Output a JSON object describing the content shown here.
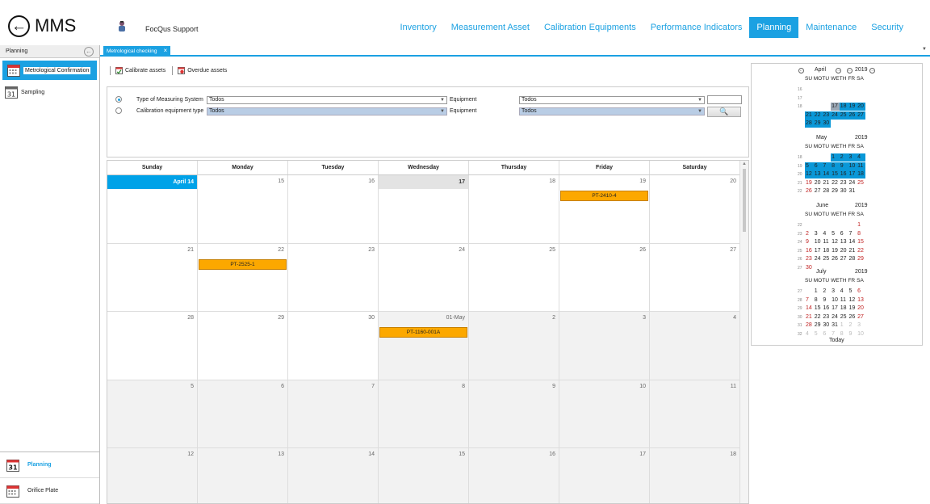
{
  "header": {
    "app_title": "MMS",
    "user_name": "FocQus Support",
    "nav": [
      "Inventory",
      "Measurement Asset",
      "Calibration Equipments",
      "Performance Indicators",
      "Planning",
      "Maintenance",
      "Security"
    ],
    "active_nav": "Planning"
  },
  "left_panel": {
    "title": "Planning",
    "items": [
      "Metrological Confirmation",
      "Sampling"
    ],
    "bottom_items": [
      "Planning",
      "Orifice Plate"
    ]
  },
  "tab": {
    "label": "Metrological checking",
    "close": "×"
  },
  "toolbar": {
    "calibrate": "Calibrate assets",
    "overdue": "Overdue assets"
  },
  "filters": {
    "type_label": "Type of Measuring System",
    "type_value": "Todos",
    "equipment_label_1": "Equipment",
    "equipment_value_1": "Todos",
    "cal_type_label": "Calibration equipment type",
    "cal_type_value": "Todos",
    "equipment_label_2": "Equipment",
    "equipment_value_2": "Todos",
    "search_icon": "🔍"
  },
  "calendar": {
    "days": [
      "Sunday",
      "Monday",
      "Tuesday",
      "Wednesday",
      "Thursday",
      "Friday",
      "Saturday"
    ],
    "weeks": [
      [
        {
          "d": "April 14",
          "today": true
        },
        {
          "d": "15"
        },
        {
          "d": "16"
        },
        {
          "d": "17",
          "sel": true
        },
        {
          "d": "18"
        },
        {
          "d": "19",
          "ev": "PT-2410-4"
        },
        {
          "d": "20"
        }
      ],
      [
        {
          "d": "21"
        },
        {
          "d": "22",
          "ev": "PT-2525-1"
        },
        {
          "d": "23"
        },
        {
          "d": "24"
        },
        {
          "d": "25"
        },
        {
          "d": "26"
        },
        {
          "d": "27"
        }
      ],
      [
        {
          "d": "28"
        },
        {
          "d": "29"
        },
        {
          "d": "30"
        },
        {
          "d": "01-May",
          "other": true,
          "ev": "PT-1160-001A"
        },
        {
          "d": "2",
          "other": true
        },
        {
          "d": "3",
          "other": true
        },
        {
          "d": "4",
          "other": true
        }
      ],
      [
        {
          "d": "5",
          "other": true
        },
        {
          "d": "6",
          "other": true
        },
        {
          "d": "7",
          "other": true
        },
        {
          "d": "8",
          "other": true
        },
        {
          "d": "9",
          "other": true
        },
        {
          "d": "10",
          "other": true
        },
        {
          "d": "11",
          "other": true
        }
      ],
      [
        {
          "d": "12",
          "other": true
        },
        {
          "d": "13",
          "other": true
        },
        {
          "d": "14",
          "other": true
        },
        {
          "d": "15",
          "other": true
        },
        {
          "d": "16",
          "other": true
        },
        {
          "d": "17",
          "other": true
        },
        {
          "d": "18",
          "other": true
        }
      ]
    ]
  },
  "date_navigator": {
    "dow": [
      "SU",
      "MO",
      "TU",
      "WE",
      "TH",
      "FR",
      "SA"
    ],
    "today_label": "Today",
    "months": [
      {
        "name": "April",
        "year": "2019",
        "nav": true,
        "weeks": [
          {
            "w": "16",
            "days": []
          },
          {
            "w": "17",
            "days": []
          },
          {
            "w": "18",
            "days": [
              "",
              "",
              "",
              "17",
              "18",
              "19",
              "20"
            ]
          },
          {
            "w": "",
            "days": [
              "21",
              "22",
              "23",
              "24",
              "25",
              "26",
              "27"
            ]
          },
          {
            "w": "",
            "days": [
              "28",
              "29",
              "30",
              "",
              "",
              "",
              ""
            ]
          }
        ]
      },
      {
        "name": "May",
        "year": "2019",
        "weeks": [
          {
            "w": "18",
            "days": [
              "",
              "",
              "",
              "1",
              "2",
              "3",
              "4"
            ]
          },
          {
            "w": "19",
            "days": [
              "5",
              "6",
              "7",
              "8",
              "9",
              "10",
              "11"
            ]
          },
          {
            "w": "20",
            "days": [
              "12",
              "13",
              "14",
              "15",
              "16",
              "17",
              "18"
            ]
          },
          {
            "w": "21",
            "days": [
              "19",
              "20",
              "21",
              "22",
              "23",
              "24",
              "25"
            ]
          },
          {
            "w": "22",
            "days": [
              "26",
              "27",
              "28",
              "29",
              "30",
              "31",
              ""
            ]
          }
        ]
      },
      {
        "name": "June",
        "year": "2019",
        "weeks": [
          {
            "w": "22",
            "days": [
              "",
              "",
              "",
              "",
              "",
              "",
              "1"
            ]
          },
          {
            "w": "23",
            "days": [
              "2",
              "3",
              "4",
              "5",
              "6",
              "7",
              "8"
            ]
          },
          {
            "w": "24",
            "days": [
              "9",
              "10",
              "11",
              "12",
              "13",
              "14",
              "15"
            ]
          },
          {
            "w": "25",
            "days": [
              "16",
              "17",
              "18",
              "19",
              "20",
              "21",
              "22"
            ]
          },
          {
            "w": "26",
            "days": [
              "23",
              "24",
              "25",
              "26",
              "27",
              "28",
              "29"
            ]
          },
          {
            "w": "27",
            "days": [
              "30",
              "",
              "",
              "",
              "",
              "",
              ""
            ]
          }
        ]
      },
      {
        "name": "July",
        "year": "2019",
        "weeks": [
          {
            "w": "27",
            "days": [
              "",
              "1",
              "2",
              "3",
              "4",
              "5",
              "6"
            ]
          },
          {
            "w": "28",
            "days": [
              "7",
              "8",
              "9",
              "10",
              "11",
              "12",
              "13"
            ]
          },
          {
            "w": "29",
            "days": [
              "14",
              "15",
              "16",
              "17",
              "18",
              "19",
              "20"
            ]
          },
          {
            "w": "30",
            "days": [
              "21",
              "22",
              "23",
              "24",
              "25",
              "26",
              "27"
            ]
          },
          {
            "w": "31",
            "days": [
              "28",
              "29",
              "30",
              "31",
              "1",
              "2",
              "3"
            ]
          },
          {
            "w": "32",
            "days": [
              "4",
              "5",
              "6",
              "7",
              "8",
              "9",
              "10"
            ]
          }
        ]
      }
    ]
  },
  "colors": {
    "accent": "#1ba1e2",
    "event": "#fca800",
    "mini_highlight": "#0a98d8"
  }
}
